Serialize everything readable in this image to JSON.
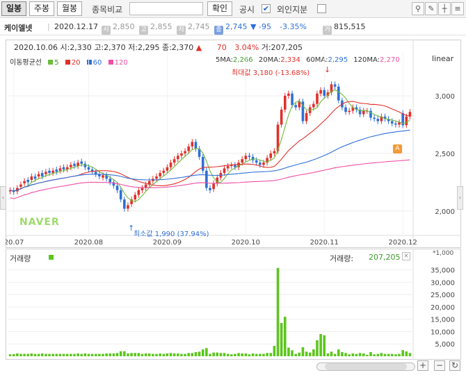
{
  "toolbar": {
    "tabs": [
      {
        "label": "일봉",
        "active": true
      },
      {
        "label": "주봉",
        "active": false
      },
      {
        "label": "월봉",
        "active": false
      }
    ],
    "compare_label": "종목비교",
    "confirm_label": "확인",
    "disclosure_label": "공시",
    "disclosure_checked": true,
    "foreign_label": "외인지분",
    "foreign_checked": false
  },
  "quote": {
    "name": "케이엘넷",
    "date": "2020.12.17",
    "open_badge": "시",
    "open": "2,850",
    "high_badge": "고",
    "high": "2,855",
    "low_badge": "저",
    "low": "2,745",
    "close_badge": "종",
    "close": "2,745",
    "change_arrow": "▼",
    "change": "-95",
    "change_pct": "-3.35%",
    "volume_badge": "거",
    "volume": "815,515"
  },
  "price_panel": {
    "info_date": "2020.10.06",
    "info_open_label": "시:",
    "info_open": "2,330",
    "info_high_label": "고:",
    "info_high": "2,370",
    "info_low_label": "저:",
    "info_low": "2,295",
    "info_close_label": "종:",
    "info_close": "2,370",
    "info_arrow": "▲",
    "info_change": "70",
    "info_pct": "3.04%",
    "info_vol_label": "거:",
    "info_vol": "207,205",
    "scale_label": "linear",
    "ma_title": "이동평균선",
    "ma_legend": [
      {
        "label": "5",
        "color": "#6cbb3c"
      },
      {
        "label": "20",
        "color": "#e0302a"
      },
      {
        "label": "60",
        "color": "#2f6fd6"
      },
      {
        "label": "120",
        "color": "#ef4fa6"
      }
    ],
    "ma_values": [
      {
        "label": "5MA:",
        "value": "2,266",
        "color": "#3b9a2a"
      },
      {
        "label": "20MA:",
        "value": "2,334",
        "color": "#e0302a"
      },
      {
        "label": "60MA:",
        "value": "2,295",
        "color": "#2f6fd6"
      },
      {
        "label": "120MA:",
        "value": "2,270",
        "color": "#ef4fa6"
      }
    ],
    "max_label": "최대값 3,180 (-13.68%)",
    "min_label": "최소값 1,990 (37.94%)",
    "logo": "NAVER"
  },
  "volume_panel": {
    "title": "거래량",
    "legend_label": "거래량:",
    "legend_value": "207,205",
    "unit": "*1,000"
  },
  "controls": {
    "plus": "+",
    "minus": "−",
    "reset": "↻"
  },
  "colors": {
    "up": "#e0302a",
    "down": "#2f6fd6",
    "volume": "#5cc61e"
  },
  "chart_data": {
    "type": "candlestick",
    "x_ticks": [
      "20.07",
      "2020.08",
      "2020.09",
      "2020.10",
      "2020.11",
      "2020.12"
    ],
    "y_ticks": [
      2000,
      2500,
      3000
    ],
    "y_labels": [
      "2,000",
      "2,500",
      "3,000"
    ],
    "ylim": [
      1860,
      3380
    ],
    "volume_ticks": [
      "35,000",
      "30,000",
      "25,000",
      "20,000",
      "15,000",
      "10,000",
      "5,000"
    ],
    "volume_tick_values": [
      35000,
      30000,
      25000,
      20000,
      15000,
      10000,
      5000
    ],
    "volume_ylim": [
      0,
      38000
    ],
    "max_point": {
      "value": 3180
    },
    "min_point": {
      "value": 1990
    },
    "close": [
      2180,
      2165,
      2200,
      2230,
      2260,
      2250,
      2300,
      2280,
      2320,
      2300,
      2340,
      2330,
      2350,
      2340,
      2370,
      2360,
      2380,
      2400,
      2390,
      2420,
      2410,
      2380,
      2360,
      2340,
      2320,
      2300,
      2310,
      2280,
      2250,
      2220,
      2180,
      2100,
      2020,
      2050,
      2100,
      2140,
      2180,
      2200,
      2230,
      2260,
      2280,
      2300,
      2330,
      2350,
      2380,
      2420,
      2450,
      2480,
      2500,
      2520,
      2560,
      2600,
      2540,
      2470,
      2350,
      2200,
      2180,
      2240,
      2290,
      2330,
      2370,
      2390,
      2400,
      2380,
      2420,
      2450,
      2480,
      2470,
      2440,
      2420,
      2400,
      2420,
      2460,
      2500,
      2520,
      2750,
      2880,
      3000,
      3020,
      2920,
      2900,
      2950,
      2780,
      2850,
      2900,
      2930,
      3020,
      3050,
      3000,
      3030,
      3100,
      3080,
      2960,
      2900,
      2860,
      2870,
      2900,
      2880,
      2840,
      2870,
      2870,
      2810,
      2800,
      2780,
      2820,
      2800,
      2780,
      2760,
      2750,
      2770,
      2745,
      2820,
      2860
    ],
    "open": [
      2170,
      2180,
      2170,
      2210,
      2240,
      2270,
      2270,
      2300,
      2300,
      2330,
      2320,
      2350,
      2330,
      2360,
      2350,
      2380,
      2360,
      2380,
      2410,
      2390,
      2430,
      2410,
      2380,
      2360,
      2340,
      2320,
      2290,
      2310,
      2280,
      2250,
      2220,
      2180,
      2100,
      2020,
      2060,
      2100,
      2140,
      2180,
      2200,
      2230,
      2260,
      2280,
      2300,
      2330,
      2350,
      2380,
      2420,
      2450,
      2480,
      2500,
      2520,
      2560,
      2600,
      2540,
      2470,
      2350,
      2200,
      2190,
      2240,
      2290,
      2330,
      2370,
      2390,
      2400,
      2380,
      2420,
      2450,
      2480,
      2470,
      2440,
      2420,
      2400,
      2420,
      2460,
      2500,
      2520,
      2750,
      2880,
      3000,
      3020,
      2920,
      2900,
      2950,
      2780,
      2850,
      2900,
      2930,
      3020,
      3050,
      3000,
      3030,
      3100,
      3080,
      2960,
      2900,
      2860,
      2870,
      2900,
      2880,
      2840,
      2870,
      2870,
      2810,
      2800,
      2780,
      2820,
      2800,
      2780,
      2760,
      2750,
      2850,
      2745,
      2820
    ]
  }
}
